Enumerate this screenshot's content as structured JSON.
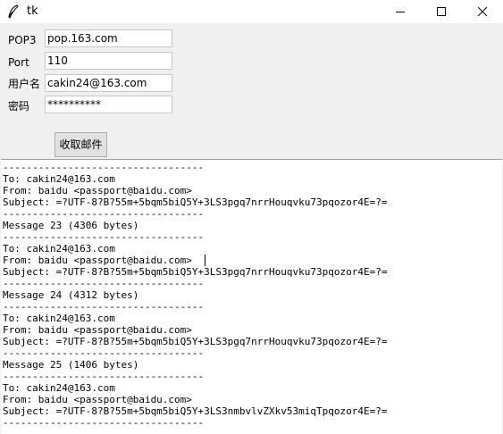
{
  "window": {
    "title": "tk",
    "icon": "feather-icon"
  },
  "form": {
    "pop3_label": "POP3",
    "pop3_value": "pop.163.com",
    "port_label": "Port",
    "port_value": "110",
    "user_label": "用户名",
    "user_value": "cakin24@163.com",
    "password_label": "密码",
    "password_value": "**********",
    "fetch_button": "收取邮件"
  },
  "output": {
    "lines": [
      "----------------------------------",
      "To: cakin24@163.com",
      "From: baidu <passport@baidu.com>",
      "Subject: =?UTF-8?B?55m+5bqm5biQ5Y+3LS3pgq7nrrHouqvku73pqozor4E=?=",
      "----------------------------------",
      "Message 23 (4306 bytes)",
      "----------------------------------",
      "To: cakin24@163.com",
      "From: baidu <passport@baidu.com>",
      "Subject: =?UTF-8?B?55m+5bqm5biQ5Y+3LS3pgq7nrrHouqvku73pqozor4E=?=",
      "----------------------------------",
      "Message 24 (4312 bytes)",
      "----------------------------------",
      "To: cakin24@163.com",
      "From: baidu <passport@baidu.com>",
      "Subject: =?UTF-8?B?55m+5bqm5biQ5Y+3LS3pgq7nrrHouqvku73pqozor4E=?=",
      "----------------------------------",
      "Message 25 (1406 bytes)",
      "----------------------------------",
      "To: cakin24@163.com",
      "From: baidu <passport@baidu.com>",
      "Subject: =?UTF-8?B?55m+5bqm5biQ5Y+3LS3nmbvlvZXkv53miqTpqozor4E=?=",
      "----------------------------------"
    ]
  }
}
